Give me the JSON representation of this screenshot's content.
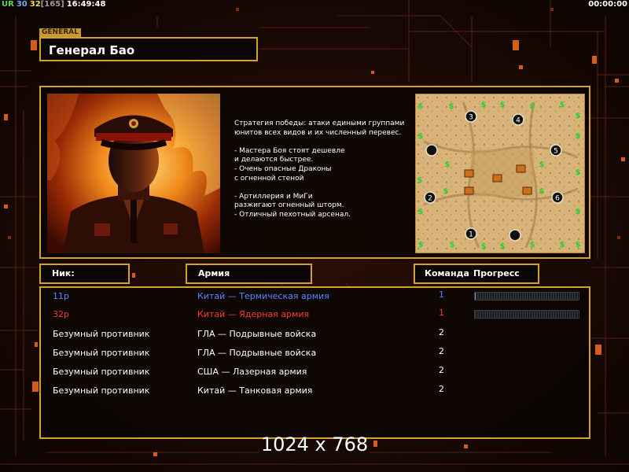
{
  "status_bar": {
    "label_ur": "UR",
    "value_30": "30",
    "value_32": "32",
    "bracket_value": "[165]",
    "clock": "16:49:48",
    "timer": "00:00:00"
  },
  "colors": {
    "accent_gold": "#d4a22a",
    "ur_green": "#56d856",
    "value_blue": "#78a8ff",
    "value_yellow": "#e8e24a",
    "bracket_gray": "#9a9a9a",
    "player_blue": "#5b86ff",
    "player_red": "#ff3a2a"
  },
  "general": {
    "tag": "GENERAL",
    "name": "Генерал Бао",
    "description": "Стратегия победы: атаки едиными группами\nюнитов всех видов и их численный перевес.\n\n- Мастера Боя стоят дешевле\nи делаются быстрее.\n- Очень опасные Драконы\nс огненной стеной\n\n- Артиллерия и МиГи\nразжигают огненный шторм.\n- Отличный пехотный арсенал."
  },
  "map": {
    "start_positions": [
      "1",
      "2",
      "3",
      "4",
      "5",
      "6"
    ],
    "resource_icon": "dollar-sign-icon"
  },
  "headers": {
    "nick": "Ник:",
    "army": "Армия",
    "team": "Команда",
    "progress": "Прогресс"
  },
  "players": [
    {
      "nick": "11p",
      "army": "Китай — Термическая армия",
      "team": "1",
      "color": "#5b86ff",
      "progress": 0.01,
      "has_progress": true
    },
    {
      "nick": "32p",
      "army": "Китай — Ядерная армия",
      "team": "1",
      "color": "#ff3a2a",
      "progress": 0,
      "has_progress": true
    },
    {
      "nick": "Безумный противник",
      "army": "ГЛА — Подрывные войска",
      "team": "2",
      "color": "#ffffff",
      "has_progress": false
    },
    {
      "nick": "Безумный противник",
      "army": "ГЛА — Подрывные войска",
      "team": "2",
      "color": "#ffffff",
      "has_progress": false
    },
    {
      "nick": "Безумный противник",
      "army": "США — Лазерная армия",
      "team": "2",
      "color": "#ffffff",
      "has_progress": false
    },
    {
      "nick": "Безумный противник",
      "army": "Китай — Танковая армия",
      "team": "2",
      "color": "#ffffff",
      "has_progress": false
    }
  ],
  "resolution_text": "1024 x 768"
}
